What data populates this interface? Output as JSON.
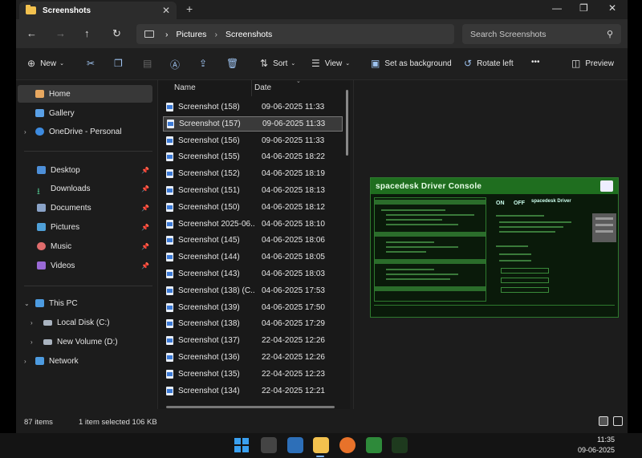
{
  "window": {
    "tab_title": "Screenshots",
    "close_glyph": "✕",
    "newtab_glyph": "+",
    "minimize_glyph": "—",
    "maximize_glyph": "❐",
    "winclose_glyph": "✕"
  },
  "address": {
    "breadcrumb": [
      "Pictures",
      "Screenshots"
    ],
    "sep": "›",
    "search_placeholder": "Search Screenshots"
  },
  "toolbar": {
    "new": "New",
    "sort": "Sort",
    "view": "View",
    "set_background": "Set as background",
    "rotate_left": "Rotate left",
    "more": "•••",
    "preview": "Preview"
  },
  "sidebar": {
    "home": "Home",
    "gallery": "Gallery",
    "onedrive": "OneDrive - Personal",
    "desktop": "Desktop",
    "downloads": "Downloads",
    "documents": "Documents",
    "pictures": "Pictures",
    "music": "Music",
    "videos": "Videos",
    "this_pc": "This PC",
    "local_disk": "Local Disk (C:)",
    "new_volume": "New Volume (D:)",
    "network": "Network"
  },
  "filelist": {
    "col_name": "Name",
    "col_date": "Date",
    "rows": [
      {
        "name": "Screenshot (158)",
        "date": "09-06-2025 11:33"
      },
      {
        "name": "Screenshot (157)",
        "date": "09-06-2025 11:33"
      },
      {
        "name": "Screenshot (156)",
        "date": "09-06-2025 11:33"
      },
      {
        "name": "Screenshot (155)",
        "date": "04-06-2025 18:22"
      },
      {
        "name": "Screenshot (152)",
        "date": "04-06-2025 18:19"
      },
      {
        "name": "Screenshot (151)",
        "date": "04-06-2025 18:13"
      },
      {
        "name": "Screenshot (150)",
        "date": "04-06-2025 18:12"
      },
      {
        "name": "Screenshot 2025-06...",
        "date": "04-06-2025 18:10"
      },
      {
        "name": "Screenshot (145)",
        "date": "04-06-2025 18:06"
      },
      {
        "name": "Screenshot (144)",
        "date": "04-06-2025 18:05"
      },
      {
        "name": "Screenshot (143)",
        "date": "04-06-2025 18:03"
      },
      {
        "name": "Screenshot (138) (C...",
        "date": "04-06-2025 17:53"
      },
      {
        "name": "Screenshot (139)",
        "date": "04-06-2025 17:50"
      },
      {
        "name": "Screenshot (138)",
        "date": "04-06-2025 17:29"
      },
      {
        "name": "Screenshot (137)",
        "date": "22-04-2025 12:26"
      },
      {
        "name": "Screenshot (136)",
        "date": "22-04-2025 12:26"
      },
      {
        "name": "Screenshot (135)",
        "date": "22-04-2025 12:23"
      },
      {
        "name": "Screenshot (134)",
        "date": "22-04-2025 12:21"
      }
    ]
  },
  "preview": {
    "title": "spacedesk Driver Console",
    "on": "ON",
    "off": "OFF",
    "driver_name": "spacedesk Driver"
  },
  "status": {
    "items": "87 items",
    "selected": "1 item selected  106 KB"
  },
  "taskbar": {
    "time": "11:35",
    "date": "09-06-2025"
  },
  "colors": {
    "accent": "#7db3f5",
    "folder": "#f2c14e",
    "preview_green": "#1f6e1f"
  }
}
